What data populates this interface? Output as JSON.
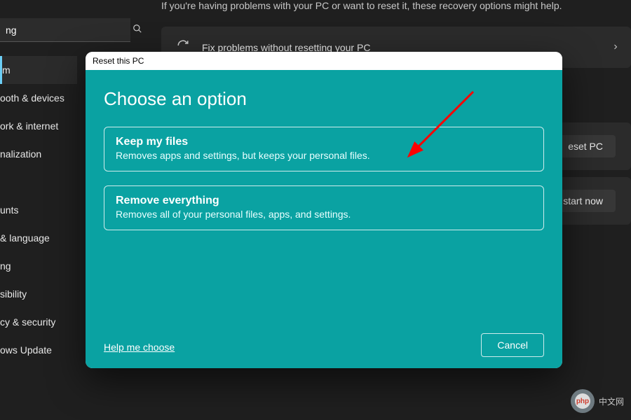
{
  "search": {
    "value": "ng"
  },
  "sidebar": {
    "items": [
      {
        "label": "m"
      },
      {
        "label": "ooth & devices"
      },
      {
        "label": "ork & internet"
      },
      {
        "label": "nalization"
      },
      {
        "label": ""
      },
      {
        "label": "unts"
      },
      {
        "label": "& language"
      },
      {
        "label": "ng"
      },
      {
        "label": "sibility"
      },
      {
        "label": "cy & security"
      },
      {
        "label": "ows Update"
      }
    ]
  },
  "page": {
    "intro": "If you're having problems with your PC or want to reset it, these recovery options might help.",
    "fix_card": "Fix problems without resetting your PC",
    "reset_btn": "eset PC",
    "restart_btn": "start now"
  },
  "dialog": {
    "title": "Reset this PC",
    "heading": "Choose an option",
    "opt1_h": "Keep my files",
    "opt1_s": "Removes apps and settings, but keeps your personal files.",
    "opt2_h": "Remove everything",
    "opt2_s": "Removes all of your personal files, apps, and settings.",
    "help": "Help me choose",
    "cancel": "Cancel"
  },
  "watermark": {
    "badge": "php",
    "text": "中文网"
  }
}
